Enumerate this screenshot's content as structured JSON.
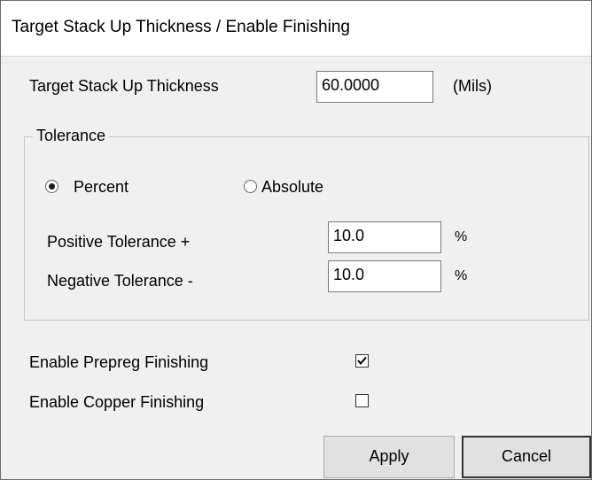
{
  "window": {
    "title": "Target Stack Up Thickness / Enable Finishing"
  },
  "thickness": {
    "label": "Target Stack Up Thickness",
    "value": "60.0000",
    "unit": "(Mils)"
  },
  "tolerance": {
    "group_label": "Tolerance",
    "options": [
      {
        "label": "Percent",
        "selected": true
      },
      {
        "label": "Absolute",
        "selected": false
      }
    ],
    "positive": {
      "label": "Positive Tolerance  +",
      "value": "10.0",
      "unit": "%"
    },
    "negative": {
      "label": "Negative Tolerance  -",
      "value": "10.0",
      "unit": "%"
    }
  },
  "finishing": {
    "prepreg": {
      "label": "Enable Prepreg Finishing",
      "checked": true
    },
    "copper": {
      "label": "Enable Copper Finishing",
      "checked": false
    }
  },
  "buttons": {
    "apply": "Apply",
    "cancel": "Cancel"
  }
}
